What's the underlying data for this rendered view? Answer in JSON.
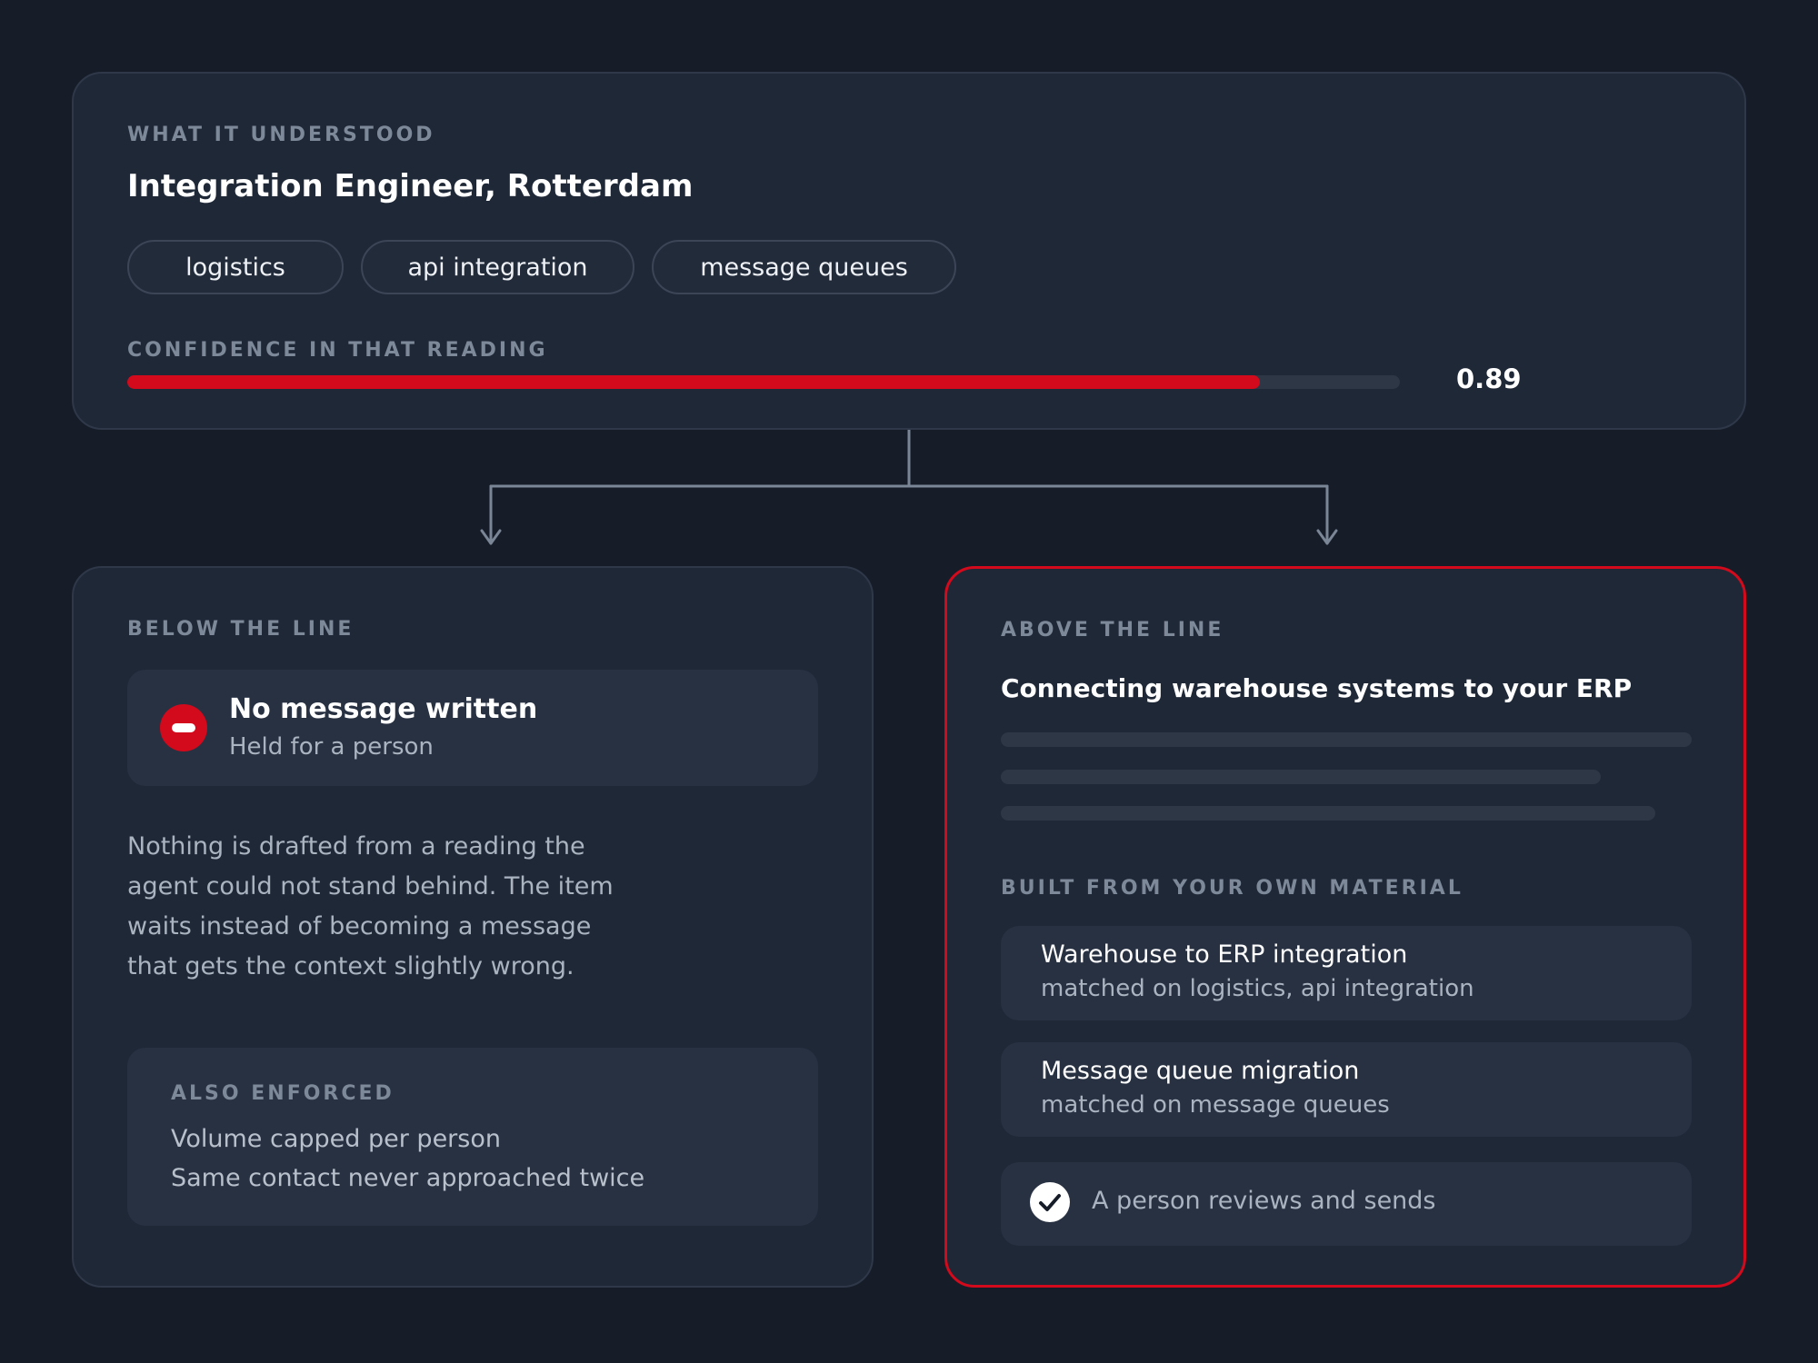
{
  "understood": {
    "label": "WHAT IT UNDERSTOOD",
    "role": "Integration Engineer, Rotterdam",
    "tags": [
      "logistics",
      "api integration",
      "message queues"
    ],
    "confidence_label": "CONFIDENCE IN THAT READING",
    "confidence_value": "0.89",
    "confidence": 0.89
  },
  "below": {
    "label": "BELOW THE LINE",
    "status_title": "No message written",
    "status_sub": "Held for a person",
    "body_lines": [
      "Nothing is drafted from a reading the",
      "agent could not stand behind. The item",
      "waits instead of becoming a message",
      "that gets the context slightly wrong."
    ],
    "enforced_label": "ALSO ENFORCED",
    "enforced_items": [
      "Volume capped per person",
      "Same contact never approached twice"
    ]
  },
  "above": {
    "label": "ABOVE THE LINE",
    "headline": "Connecting warehouse systems to your ERP",
    "material_label": "BUILT FROM YOUR OWN MATERIAL",
    "materials": [
      {
        "title": "Warehouse to ERP integration",
        "sub": "matched on logistics, api integration"
      },
      {
        "title": "Message queue migration",
        "sub": "matched on message queues"
      }
    ],
    "review_label": "A person reviews and sends"
  },
  "colors": {
    "accent": "#d20a1c",
    "background": "#161d29",
    "card": "#1f2837",
    "muted_text": "#aab3c0"
  }
}
